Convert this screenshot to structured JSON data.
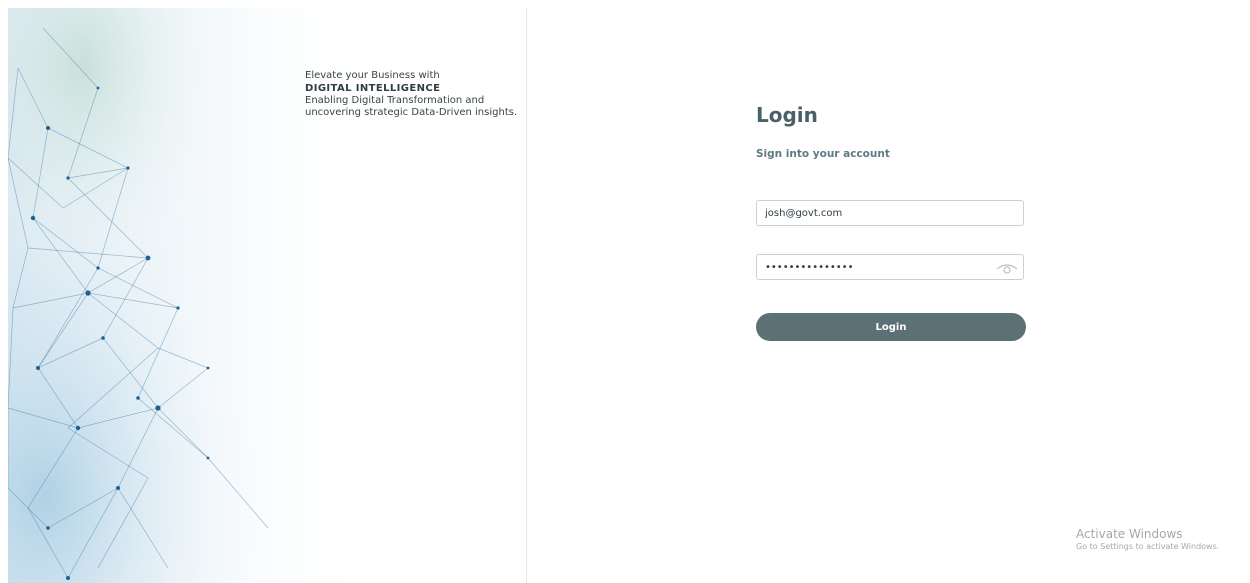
{
  "hero": {
    "tagline_line1": "Elevate your Business with",
    "brand": "DIGITAL INTELLIGENCE",
    "description": "Enabling Digital Transformation and uncovering strategic Data-Driven insights."
  },
  "login": {
    "title": "Login",
    "subtitle": "Sign into your account",
    "email_value": "josh@govt.com",
    "password_value": "•••••••••••••••",
    "button_label": "Login"
  },
  "watermark": {
    "title": "Activate Windows",
    "subtitle": "Go to Settings to activate Windows."
  },
  "colors": {
    "accent": "#5c7176",
    "title": "#4a6068",
    "network": "#2f6f9e"
  },
  "icons": {
    "password_toggle": "eye-icon"
  }
}
